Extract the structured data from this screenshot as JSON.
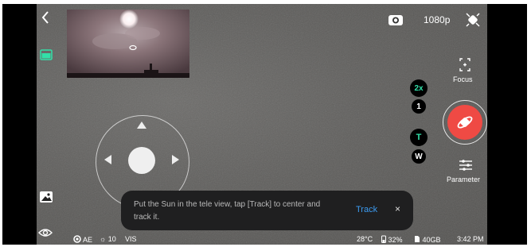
{
  "top_bar": {
    "resolution": "1080p"
  },
  "right_controls": {
    "focus_label": "Focus",
    "zoom_levels": [
      "2x",
      "1"
    ],
    "lens_options": [
      "T",
      "W"
    ],
    "parameter_label": "Parameter"
  },
  "toast": {
    "message": "Put the Sun in the tele view, tap [Track] to center and track it.",
    "action_label": "Track",
    "close_glyph": "×"
  },
  "status_bar": {
    "ae_label": "AE",
    "brightness_value": "10",
    "vis_label": "VIS",
    "temperature": "28°C",
    "battery": "32%",
    "storage": "40GB",
    "time": "3:42 PM"
  },
  "colors": {
    "accent_green": "#32e0a8",
    "shutter_red": "#ef4a44",
    "link_blue": "#3c9bf0"
  },
  "icons": {
    "back": "chevron-left-icon",
    "layout": "layout-icon",
    "gallery": "gallery-icon",
    "eye": "eye-icon",
    "camera": "camera-icon",
    "satellite": "satellite-icon",
    "focus": "focus-icon",
    "parameter": "sliders-icon"
  }
}
